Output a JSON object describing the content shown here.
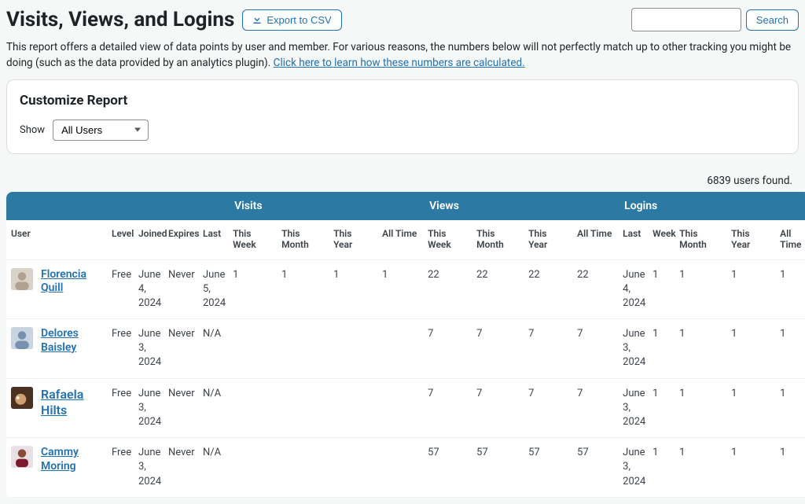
{
  "header": {
    "title": "Visits, Views, and Logins",
    "export_label": "Export to CSV",
    "search_button": "Search"
  },
  "description": {
    "text": "This report offers a detailed view of data points by user and member. For various reasons, the numbers below will not perfectly match up to other tracking you might be doing (such as the data provided by an analytics plugin). ",
    "link_text": "Click here to learn how these numbers are calculated."
  },
  "panel": {
    "heading": "Customize Report",
    "show_label": "Show",
    "show_value": "All Users"
  },
  "count_text": "6839 users found.",
  "table": {
    "group_headers": [
      "",
      "Visits",
      "Views",
      "Logins"
    ],
    "columns": [
      "User",
      "Level",
      "Joined",
      "Expires",
      "Last",
      "This Week",
      "This Month",
      "This Year",
      "All Time",
      "This Week",
      "This Month",
      "This Year",
      "All Time",
      "Last",
      "Week",
      "This Month",
      "This Year",
      "All Time"
    ],
    "rows": [
      {
        "user": "Florencia Quill",
        "big": false,
        "level": "Free",
        "joined": "June 4, 2024",
        "expires": "Never",
        "v_last": "June 5, 2024",
        "v_tw": "1",
        "v_tm": "1",
        "v_ty": "1",
        "v_at": "1",
        "w_tw": "22",
        "w_tm": "22",
        "w_ty": "22",
        "w_at": "22",
        "l_last": "June 4, 2024",
        "l_w": "1",
        "l_tm": "1",
        "l_ty": "1",
        "l_at": "1"
      },
      {
        "user": "Delores Baisley",
        "big": false,
        "level": "Free",
        "joined": "June 3, 2024",
        "expires": "Never",
        "v_last": "N/A",
        "v_tw": "",
        "v_tm": "",
        "v_ty": "",
        "v_at": "",
        "w_tw": "7",
        "w_tm": "7",
        "w_ty": "7",
        "w_at": "7",
        "l_last": "June 3, 2024",
        "l_w": "1",
        "l_tm": "1",
        "l_ty": "1",
        "l_at": "1"
      },
      {
        "user": "Rafaela Hilts",
        "big": true,
        "level": "Free",
        "joined": "June 3, 2024",
        "expires": "Never",
        "v_last": "N/A",
        "v_tw": "",
        "v_tm": "",
        "v_ty": "",
        "v_at": "",
        "w_tw": "7",
        "w_tm": "7",
        "w_ty": "7",
        "w_at": "7",
        "l_last": "June 3, 2024",
        "l_w": "1",
        "l_tm": "1",
        "l_ty": "1",
        "l_at": "1"
      },
      {
        "user": "Cammy Moring",
        "big": false,
        "level": "Free",
        "joined": "June 3, 2024",
        "expires": "Never",
        "v_last": "N/A",
        "v_tw": "",
        "v_tm": "",
        "v_ty": "",
        "v_at": "",
        "w_tw": "57",
        "w_tm": "57",
        "w_ty": "57",
        "w_at": "57",
        "l_last": "June 3, 2024",
        "l_w": "1",
        "l_tm": "1",
        "l_ty": "1",
        "l_at": "1"
      }
    ]
  }
}
